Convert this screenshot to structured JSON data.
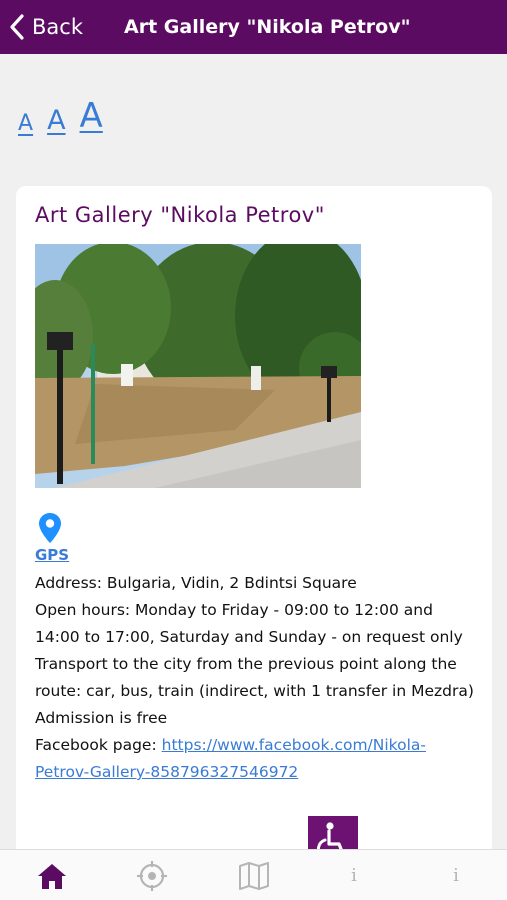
{
  "header": {
    "back_label": "Back",
    "title": "Art Gallery \"Nikola Petrov\""
  },
  "font_size_controls": {
    "small": "A",
    "medium": "A",
    "large": "A"
  },
  "gallery": {
    "title": "Art Gallery \"Nikola Petrov\"",
    "gps_label": "GPS",
    "address": "Address: Bulgaria, Vidin, 2 Bdintsi Square",
    "open_hours": "Open hours: Monday to Friday - 09:00 to 12:00 and 14:00 to 17:00, Saturday and Sunday - on request only",
    "transport": "Transport to the city from the previous point along the route: car, bus, train (indirect, with 1 transfer in Mezdra)",
    "admission": "Admission is free",
    "facebook_label": "Facebook page: ",
    "facebook_url": "https://www.facebook.com/Nikola-Petrov-Gallery-858796327546972"
  },
  "bottom_nav": {
    "info_1": "i",
    "info_2": "i"
  },
  "colors": {
    "brand": "#5b0b62",
    "link": "#3a7bd5",
    "inactive_icon": "#b5b5b5"
  },
  "icons": [
    "chevron-left-icon",
    "map-pin-icon",
    "wheelchair-icon",
    "home-icon",
    "crosshair-icon",
    "map-icon",
    "info-icon"
  ]
}
